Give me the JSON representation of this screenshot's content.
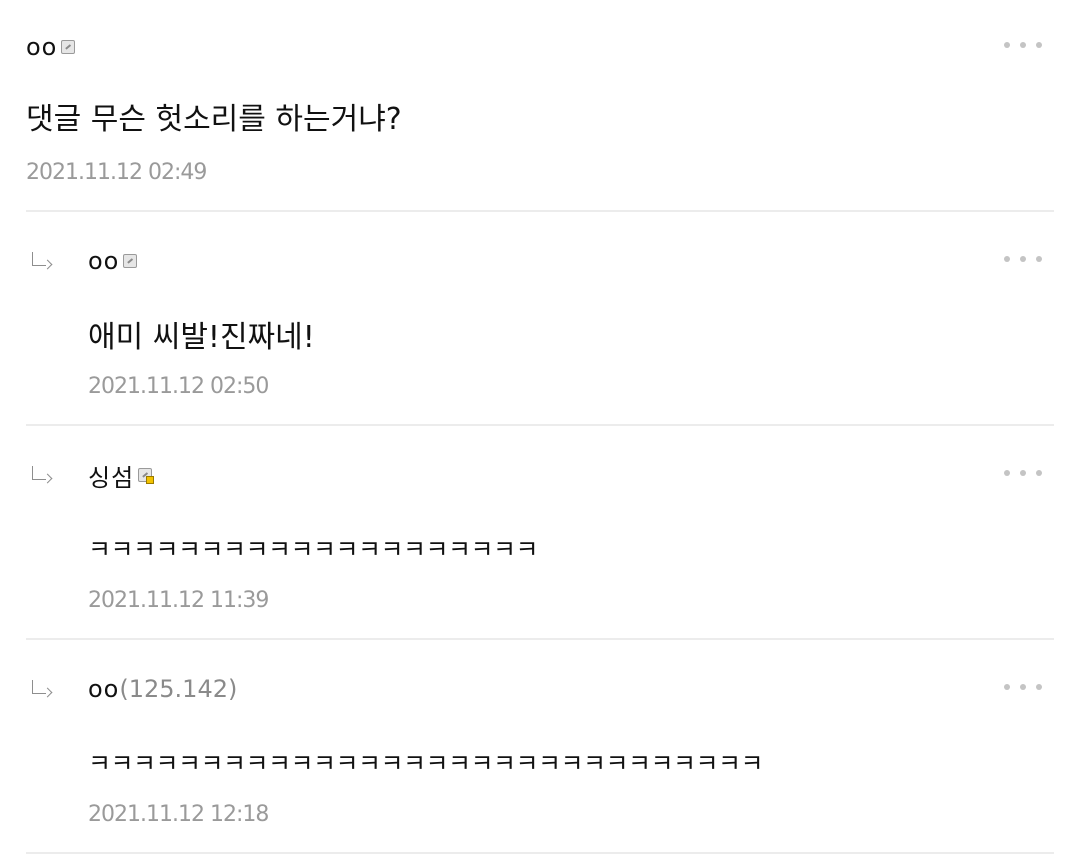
{
  "comments": [
    {
      "author": "oo",
      "ip": "",
      "badge": "fixed-member-badge",
      "text": "댓글 무슨 헛소리를 하는거냐?",
      "date": "2021.11.12 02:49",
      "is_reply": false
    },
    {
      "author": "oo",
      "ip": "",
      "badge": "fixed-member-badge",
      "text": "애미 씨발!진짜네!",
      "date": "2021.11.12 02:50",
      "is_reply": true
    },
    {
      "author": "싱섬",
      "ip": "",
      "badge": "half-member-badge",
      "text": "ㅋㅋㅋㅋㅋㅋㅋㅋㅋㅋㅋㅋㅋㅋㅋㅋㅋㅋㅋㅋ",
      "date": "2021.11.12 11:39",
      "is_reply": true
    },
    {
      "author": "oo",
      "ip": "(125.142)",
      "badge": "",
      "text": "ㅋㅋㅋㅋㅋㅋㅋㅋㅋㅋㅋㅋㅋㅋㅋㅋㅋㅋㅋㅋㅋㅋㅋㅋㅋㅋㅋㅋㅋㅋ",
      "date": "2021.11.12 12:18",
      "is_reply": true
    }
  ],
  "icons": {
    "more": "more-options-icon",
    "reply": "reply-arrow-icon"
  },
  "colors": {
    "date": "#9a9a9a",
    "divider": "#ececec",
    "half_badge": "#f2c200"
  }
}
